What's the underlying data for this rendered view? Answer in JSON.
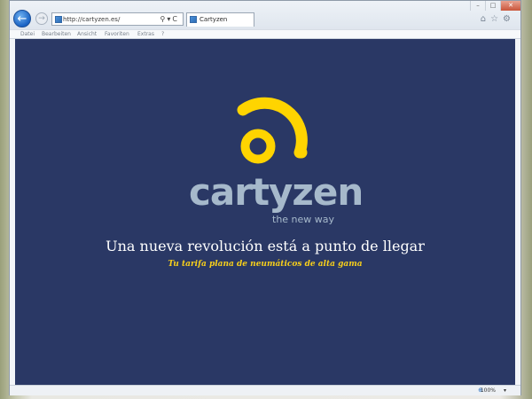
{
  "browser": {
    "address": "http://cartyzen.es/",
    "address_icons": "⚲▾C",
    "back_glyph": "←",
    "forward_glyph": "→",
    "tab_title": "Cartyzen",
    "right_icons": "⌂☆⚙",
    "window_controls": {
      "minimize": "–",
      "maximize": "□",
      "close": "✕"
    },
    "menu": [
      "Datei",
      "Bearbeiten",
      "Ansicht",
      "Favoriten",
      "Extras",
      "?"
    ],
    "zoom_icon": "⊕",
    "zoom": "100%",
    "zoom_arrow": "▾"
  },
  "page": {
    "logo_word": "cartyzen",
    "logo_tagline": "the new way",
    "headline": "Una nueva revolución está a punto de llegar",
    "subheadline": "Tu tarifa plana de neumáticos de alta gama"
  },
  "colors": {
    "page_background": "#2a3865",
    "logo_yellow": "#ffd400",
    "logo_text": "#a6b9cb",
    "subheadline": "#f7cf1b"
  },
  "icons": {
    "back": "back-arrow-icon",
    "forward": "forward-arrow-icon",
    "search": "search-icon",
    "refresh": "refresh-icon",
    "home": "home-icon",
    "favorites": "star-icon",
    "tools": "gear-icon",
    "logo": "signal-ring-logo-icon"
  }
}
